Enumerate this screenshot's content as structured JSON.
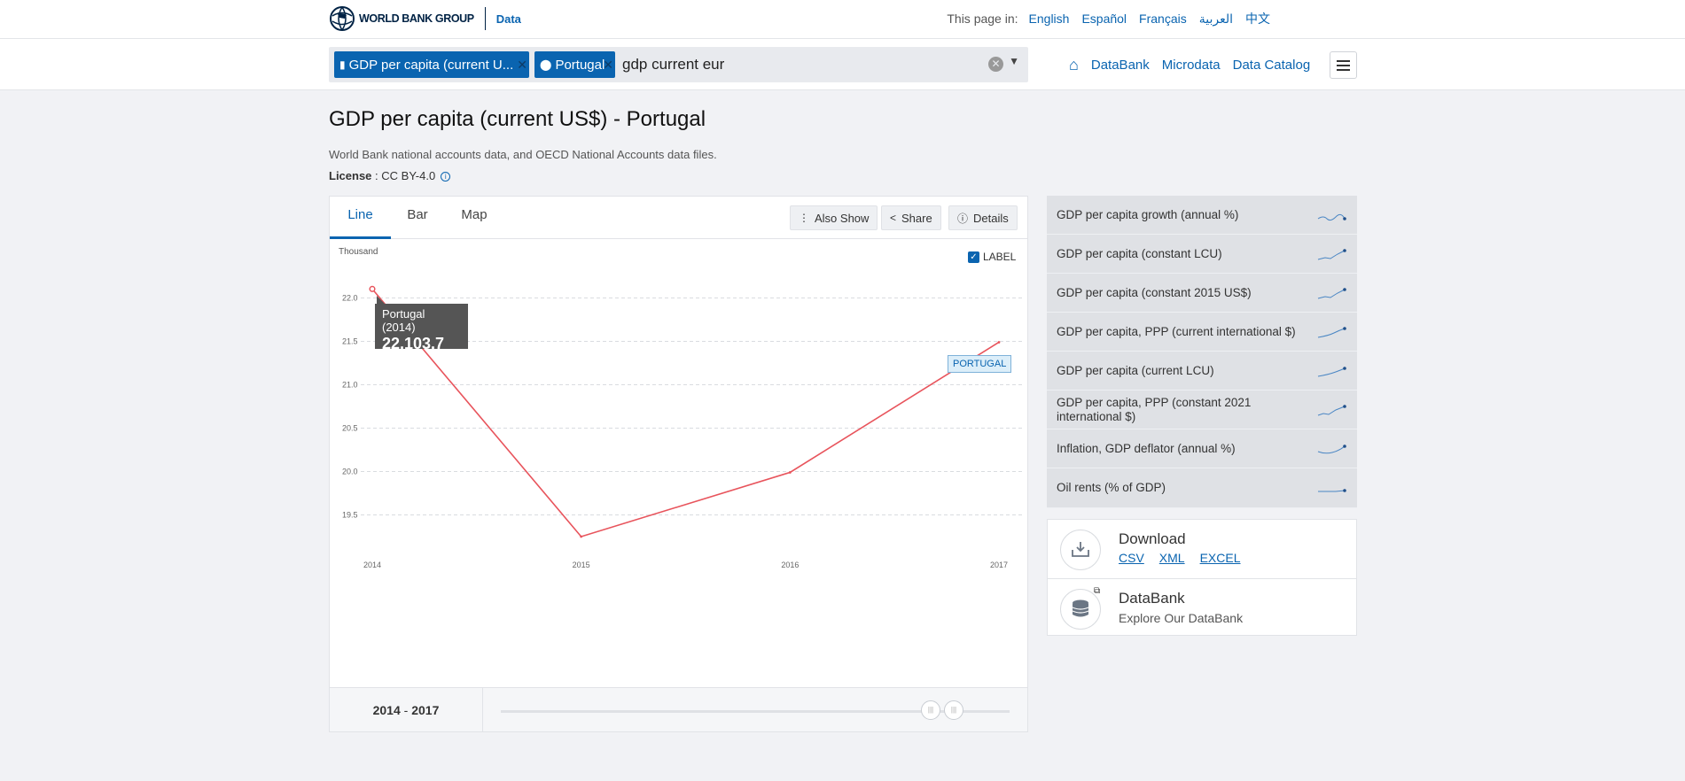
{
  "header": {
    "logo_text": "WORLD BANK GROUP",
    "logo_product": "Data",
    "lang_label": "This page in:",
    "languages": [
      "English",
      "Español",
      "Français",
      "العربية",
      "中文"
    ]
  },
  "search": {
    "chip_indicator": "GDP per capita (current U...",
    "chip_country": "Portugal",
    "query": "gdp current eur",
    "nav": [
      "DataBank",
      "Microdata",
      "Data Catalog"
    ]
  },
  "page": {
    "title": "GDP per capita (current US$) - Portugal",
    "source": "World Bank national accounts data, and OECD National Accounts data files.",
    "license_label": "License",
    "license_value": " : CC BY-4.0"
  },
  "chart_tabs": [
    "Line",
    "Bar",
    "Map"
  ],
  "chart_tools": {
    "also_show": "Also Show",
    "share": "Share",
    "details": "Details",
    "label_toggle": "LABEL"
  },
  "tooltip": {
    "name": "Portugal (2014)",
    "value": "22,103.7"
  },
  "chart_data": {
    "type": "line",
    "unit_label": "Thousand",
    "x": [
      2014,
      2015,
      2016,
      2017
    ],
    "x_ticks": [
      "2014",
      "2015",
      "2016",
      "2017"
    ],
    "y_ticks": [
      "19.5",
      "20.0",
      "20.5",
      "21.0",
      "21.5",
      "22.0"
    ],
    "ylim": [
      19.25,
      22.25
    ],
    "series": [
      {
        "name": "PORTUGAL",
        "values": [
          22.1037,
          19.25,
          19.99,
          21.49
        ],
        "color": "#e8545c"
      }
    ],
    "grid": true
  },
  "range": {
    "start": "2014",
    "sep": " - ",
    "end": "2017"
  },
  "related": [
    {
      "label": "GDP per capita growth (annual %)",
      "icon": "sparkline-icon"
    },
    {
      "label": "GDP per capita (constant LCU)",
      "icon": "sparkline-icon"
    },
    {
      "label": "GDP per capita (constant 2015 US$)",
      "icon": "sparkline-icon"
    },
    {
      "label": "GDP per capita, PPP (current international $)",
      "icon": "sparkline-icon"
    },
    {
      "label": "GDP per capita (current LCU)",
      "icon": "sparkline-icon"
    },
    {
      "label": "GDP per capita, PPP (constant 2021 international $)",
      "icon": "sparkline-icon"
    },
    {
      "label": "Inflation, GDP deflator (annual %)",
      "icon": "sparkline-icon"
    },
    {
      "label": "Oil rents (% of GDP)",
      "icon": "sparkline-icon"
    }
  ],
  "download": {
    "title": "Download",
    "links": [
      "CSV",
      "XML",
      "EXCEL"
    ]
  },
  "databank": {
    "title": "DataBank",
    "subtitle": "Explore Our DataBank"
  },
  "colors": {
    "accent": "#0a64b0",
    "series": "#e8545c"
  }
}
